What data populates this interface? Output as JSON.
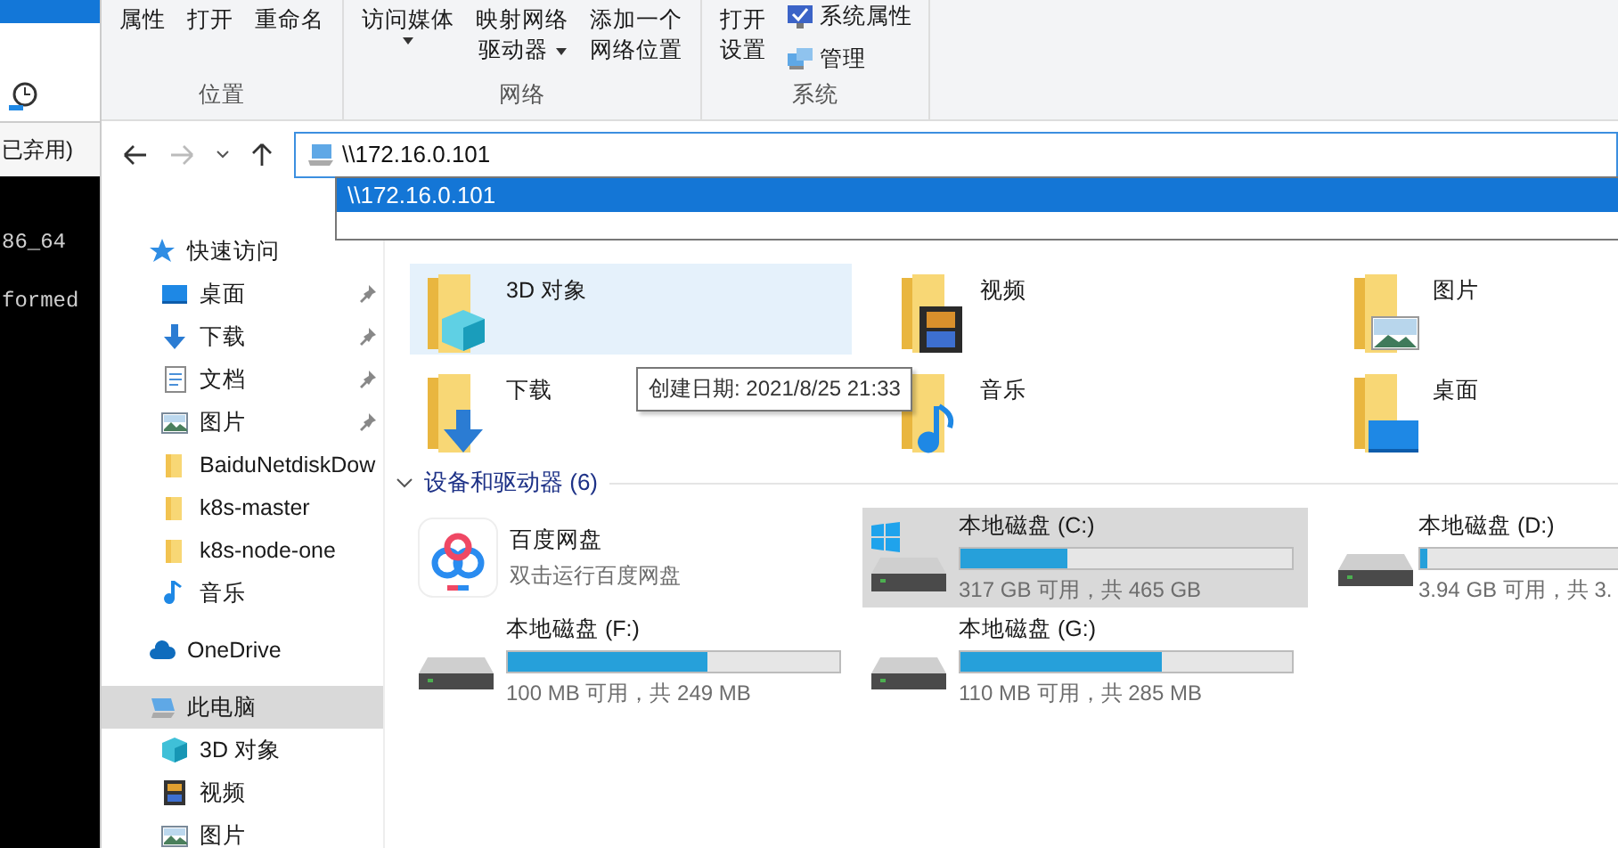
{
  "background_window": {
    "address_fragment": "已弃用)",
    "terminal_lines": [
      "86_64",
      "formed"
    ]
  },
  "ribbon": {
    "groups": [
      {
        "label": "位置",
        "buttons": [
          {
            "kind": "large",
            "lines": [
              "属性"
            ],
            "dropdown": false
          },
          {
            "kind": "large",
            "lines": [
              "打开"
            ],
            "dropdown": false
          },
          {
            "kind": "large",
            "lines": [
              "重命名"
            ],
            "dropdown": false
          }
        ]
      },
      {
        "label": "网络",
        "buttons": [
          {
            "kind": "large",
            "lines": [
              "访问媒体"
            ],
            "dropdown": true
          },
          {
            "kind": "large",
            "lines": [
              "映射网络",
              "驱动器"
            ],
            "dropdown": true
          },
          {
            "kind": "large",
            "lines": [
              "添加一个",
              "网络位置"
            ],
            "dropdown": false
          }
        ]
      },
      {
        "label": "系统",
        "buttons": [
          {
            "kind": "large",
            "lines": [
              "打开",
              "设置"
            ],
            "dropdown": false
          },
          {
            "kind": "small",
            "lines": [
              "系统属性"
            ],
            "dropdown": false
          },
          {
            "kind": "small",
            "lines": [
              "管理"
            ],
            "dropdown": false
          }
        ]
      }
    ]
  },
  "navigation": {
    "back_enabled": true,
    "forward_enabled": false
  },
  "address": {
    "value": "\\\\172.16.0.101"
  },
  "autocomplete": [
    {
      "label": "\\\\172.16.0.101",
      "selected": true
    }
  ],
  "sidebar": {
    "items": [
      {
        "kind": "star",
        "label": "快速访问",
        "selected": false,
        "children": [
          {
            "kind": "desktop",
            "label": "桌面",
            "pinned": true,
            "selected": false
          },
          {
            "kind": "download",
            "label": "下载",
            "pinned": true,
            "selected": false
          },
          {
            "kind": "document",
            "label": "文档",
            "pinned": true,
            "selected": false
          },
          {
            "kind": "picture",
            "label": "图片",
            "pinned": true,
            "selected": false
          },
          {
            "kind": "folder",
            "label": "BaiduNetdiskDow",
            "pinned": false,
            "selected": false
          },
          {
            "kind": "folder",
            "label": "k8s-master",
            "pinned": false,
            "selected": false
          },
          {
            "kind": "folder",
            "label": "k8s-node-one",
            "pinned": false,
            "selected": false
          },
          {
            "kind": "music",
            "label": "音乐",
            "pinned": false,
            "selected": false
          }
        ]
      },
      {
        "kind": "cloud",
        "label": "OneDrive",
        "selected": false
      },
      {
        "kind": "pc",
        "label": "此电脑",
        "selected": true,
        "children": [
          {
            "kind": "cube",
            "label": "3D 对象",
            "pinned": false,
            "selected": false
          },
          {
            "kind": "video",
            "label": "视频",
            "pinned": false,
            "selected": false
          },
          {
            "kind": "picture",
            "label": "图片",
            "pinned": false,
            "selected": false
          }
        ]
      }
    ]
  },
  "folders": [
    {
      "kind": "cube",
      "label": "3D 对象",
      "hovered": true
    },
    {
      "kind": "video",
      "label": "视频",
      "hovered": false
    },
    {
      "kind": "picture",
      "label": "图片",
      "hovered": false
    },
    {
      "kind": "download",
      "label": "下载",
      "hovered": false
    },
    {
      "kind": "music",
      "label": "音乐",
      "hovered": false
    },
    {
      "kind": "desktop",
      "label": "桌面",
      "hovered": false
    }
  ],
  "tooltip": "创建日期: 2021/8/25 21:33",
  "drives_section": {
    "title": "设备和驱动器 (6)",
    "expanded": true
  },
  "drives": [
    {
      "kind": "app",
      "name": "百度网盘",
      "subtitle": "双击运行百度网盘",
      "selected": false
    },
    {
      "kind": "disk",
      "name": "本地磁盘 (C:)",
      "system": true,
      "level": 0.32,
      "reading": "317 GB 可用，共 465 GB",
      "selected": true
    },
    {
      "kind": "disk",
      "name": "本地磁盘 (D:)",
      "system": false,
      "level": 0.02,
      "reading": "3.94 GB 可用，共 3.",
      "selected": false
    },
    {
      "kind": "disk",
      "name": "本地磁盘 (F:)",
      "system": false,
      "level": 0.6,
      "reading": "100 MB 可用，共 249 MB",
      "selected": false
    },
    {
      "kind": "disk",
      "name": "本地磁盘 (G:)",
      "system": false,
      "level": 0.61,
      "reading": "110 MB 可用，共 285 MB",
      "selected": false
    }
  ]
}
